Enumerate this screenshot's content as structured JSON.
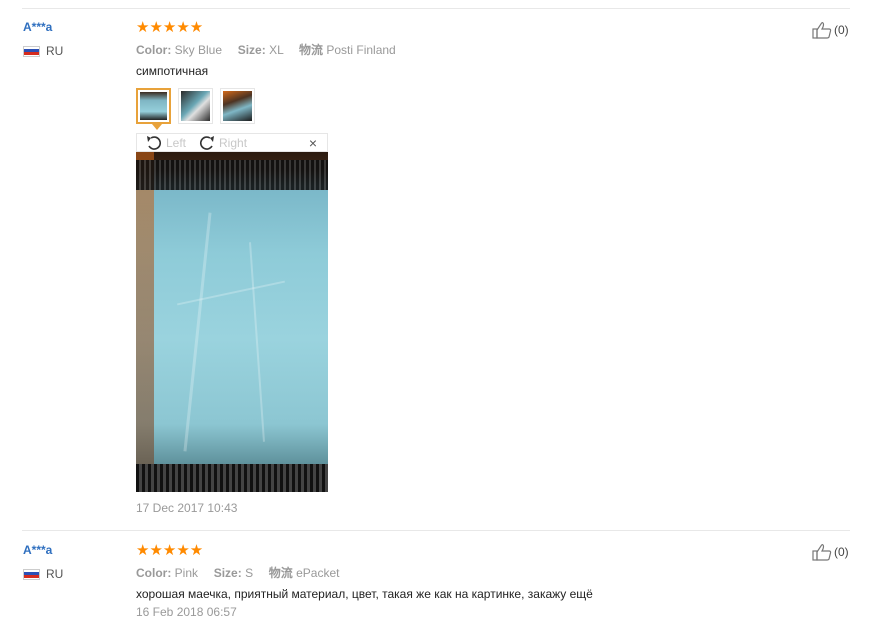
{
  "reviews": [
    {
      "user": "A***a",
      "country": "RU",
      "stars": "★★★★★",
      "color_label": "Color:",
      "color_value": "Sky Blue",
      "size_label": "Size:",
      "size_value": "XL",
      "logistics_label": "物流",
      "logistics_value": "Posti Finland",
      "text": "симпотичная",
      "helpful_count": "(0)",
      "date": "17 Dec 2017 10:43",
      "viewer": {
        "left_label": "Left",
        "right_label": "Right",
        "close_label": "×"
      }
    },
    {
      "user": "A***a",
      "country": "RU",
      "stars": "★★★★★",
      "color_label": "Color:",
      "color_value": "Pink",
      "size_label": "Size:",
      "size_value": "S",
      "logistics_label": "物流",
      "logistics_value": "ePacket",
      "text": "хорошая маечка, приятный материал, цвет, такая же как на картинке, закажу ещё",
      "helpful_count": "(0)",
      "date": "16 Feb 2018 06:57"
    }
  ],
  "colors": {
    "star": "#ff8a00",
    "link": "#2f6fbf",
    "accent": "#e8a23a"
  }
}
